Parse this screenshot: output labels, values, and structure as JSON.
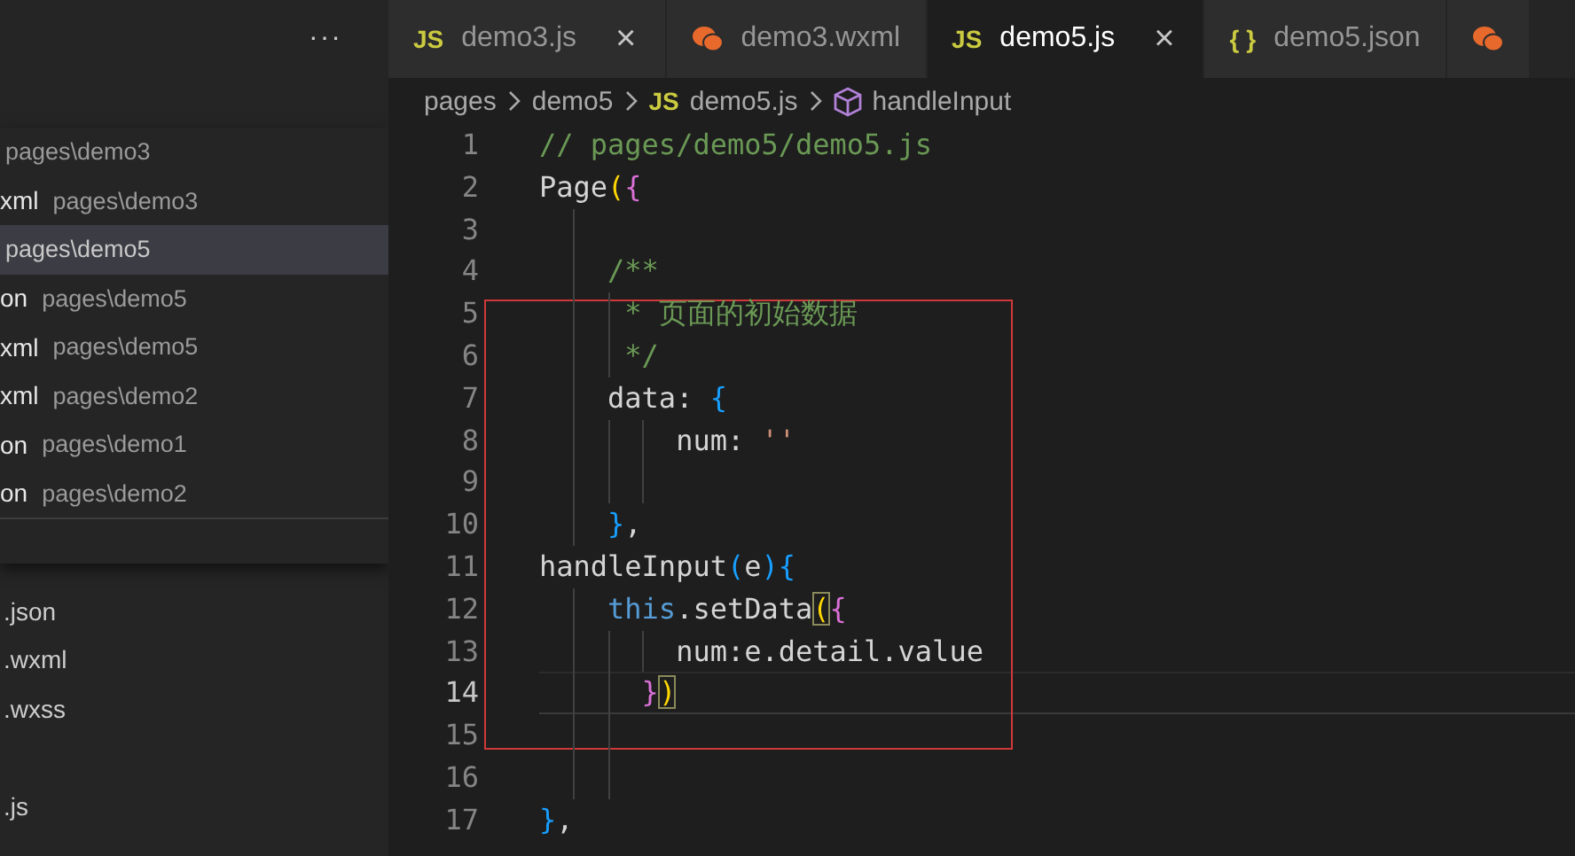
{
  "sidebar": {
    "more": "···",
    "quick_open": [
      {
        "path": "pages\\demo3",
        "selected": false
      },
      {
        "name": "xml",
        "path": "pages\\demo3",
        "selected": false
      },
      {
        "path": "pages\\demo5",
        "selected": true
      },
      {
        "name": "on",
        "path": "pages\\demo5",
        "selected": false
      },
      {
        "name": "xml",
        "path": "pages\\demo5",
        "selected": false
      },
      {
        "name": "xml",
        "path": "pages\\demo2",
        "selected": false
      },
      {
        "name": "on",
        "path": "pages\\demo1",
        "selected": false
      },
      {
        "name": "on",
        "path": "pages\\demo2",
        "selected": false
      }
    ],
    "explorer_groups": [
      {
        "files": [
          ".json",
          ".wxml",
          ".wxss"
        ]
      },
      {
        "files": [
          ".js"
        ]
      }
    ]
  },
  "tabs": [
    {
      "kind": "js",
      "icon": "JS",
      "label": "demo3.js",
      "close": "×",
      "selected": false
    },
    {
      "kind": "wechat",
      "label": "demo3.wxml",
      "selected": false
    },
    {
      "kind": "js",
      "icon": "JS",
      "label": "demo5.js",
      "close": "×",
      "selected": true
    },
    {
      "kind": "json",
      "icon": "{ }",
      "label": "demo5.json",
      "selected": false
    },
    {
      "kind": "wechat",
      "selected": false
    }
  ],
  "breadcrumbs": [
    {
      "kind": "folder",
      "label": "pages"
    },
    {
      "kind": "folder",
      "label": "demo5"
    },
    {
      "kind": "js",
      "icon": "JS",
      "label": "demo5.js"
    },
    {
      "kind": "symbol",
      "label": "handleInput"
    }
  ],
  "code": [
    {
      "number": "1",
      "current": false,
      "boxed": false,
      "tokens": [
        {
          "text": "// pages/demo5/demo5.js",
          "kind": "comment"
        }
      ]
    },
    {
      "number": "2",
      "current": false,
      "boxed": false,
      "tokens": [
        {
          "text": "Page",
          "kind": "ident"
        },
        {
          "text": "(",
          "kind": "b1"
        },
        {
          "text": "{",
          "kind": "b2"
        }
      ]
    },
    {
      "number": "3",
      "current": false,
      "boxed": false
    },
    {
      "number": "4",
      "current": false,
      "boxed": false,
      "tokens": [
        {
          "text": "    /**",
          "kind": "comment"
        }
      ]
    },
    {
      "number": "5",
      "current": false,
      "boxed": true,
      "tokens": [
        {
          "text": "     * 页面的初始数据",
          "kind": "comment"
        }
      ]
    },
    {
      "number": "6",
      "current": false,
      "boxed": true,
      "tokens": [
        {
          "text": "     */",
          "kind": "comment"
        }
      ]
    },
    {
      "number": "7",
      "current": false,
      "boxed": true,
      "tokens": [
        {
          "text": "    data: ",
          "kind": "ident"
        },
        {
          "text": "{",
          "kind": "b3"
        }
      ]
    },
    {
      "number": "8",
      "current": false,
      "boxed": true,
      "tokens": [
        {
          "text": "        num: ",
          "kind": "ident"
        },
        {
          "text": "''",
          "kind": "string"
        }
      ]
    },
    {
      "number": "9",
      "current": false,
      "boxed": true
    },
    {
      "number": "10",
      "current": false,
      "boxed": true,
      "tokens": [
        {
          "text": "    }",
          "kind": "b3"
        },
        {
          "text": ",",
          "kind": "ident"
        }
      ]
    },
    {
      "number": "11",
      "current": false,
      "boxed": true,
      "tokens": [
        {
          "text": "handleInput",
          "kind": "ident"
        },
        {
          "text": "(",
          "kind": "b3"
        },
        {
          "text": "e",
          "kind": "ident"
        },
        {
          "text": ")",
          "kind": "b3"
        },
        {
          "text": "{",
          "kind": "b3"
        }
      ]
    },
    {
      "number": "12",
      "current": false,
      "boxed": true,
      "tokens": [
        {
          "text": "    this",
          "kind": "keyword"
        },
        {
          "text": ".setData",
          "kind": "ident"
        },
        {
          "text": "(",
          "kind": "b1m"
        },
        {
          "text": "{",
          "kind": "b2"
        }
      ]
    },
    {
      "number": "13",
      "current": false,
      "boxed": true,
      "tokens": [
        {
          "text": "        num:e.detail.value",
          "kind": "ident"
        }
      ]
    },
    {
      "number": "14",
      "current": true,
      "boxed": true,
      "tokens": [
        {
          "text": "      }",
          "kind": "b2"
        },
        {
          "text": ")",
          "kind": "b1m"
        }
      ]
    },
    {
      "number": "15",
      "current": false,
      "boxed": true
    },
    {
      "number": "16",
      "current": false,
      "boxed": false
    },
    {
      "number": "17",
      "current": false,
      "boxed": false,
      "tokens": [
        {
          "text": "}",
          "kind": "b3"
        },
        {
          "text": ",",
          "kind": "ident"
        }
      ]
    }
  ]
}
